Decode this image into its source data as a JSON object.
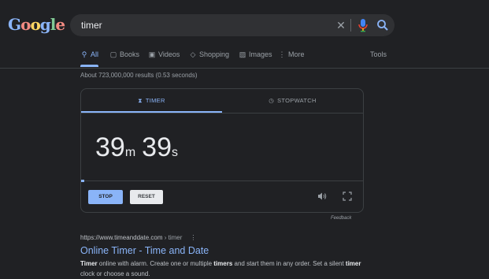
{
  "logo": {
    "text": "Google"
  },
  "search": {
    "query": "timer"
  },
  "tabs": [
    {
      "label": "All",
      "icon": "search-icon",
      "active": true
    },
    {
      "label": "Books",
      "icon": "book-icon"
    },
    {
      "label": "Videos",
      "icon": "video-icon"
    },
    {
      "label": "Shopping",
      "icon": "tag-icon"
    },
    {
      "label": "Images",
      "icon": "image-icon"
    },
    {
      "label": "More",
      "icon": "kebab-icon"
    }
  ],
  "tools_label": "Tools",
  "result_stats": "About 723,000,000 results (0.53 seconds)",
  "timer": {
    "tab_timer": "TIMER",
    "tab_stopwatch": "STOPWATCH",
    "minutes": "39",
    "minutes_unit": "m",
    "seconds": "39",
    "seconds_unit": "s",
    "progress": 0.01,
    "stop_label": "STOP",
    "reset_label": "RESET",
    "feedback_label": "Feedback"
  },
  "result": {
    "url_domain": "https://www.timeanddate.com",
    "url_path": " › timer",
    "title": "Online Timer - Time and Date",
    "snippet_bold1": "Timer",
    "snippet_text1": " online with alarm. Create one or multiple ",
    "snippet_bold2": "timers",
    "snippet_text2": " and start them in any order. Set a silent ",
    "snippet_bold3": "timer",
    "snippet_text3": " clock or choose a sound."
  },
  "colors": {
    "accent": "#8ab4f8",
    "background": "#202124",
    "surface": "#303134"
  }
}
